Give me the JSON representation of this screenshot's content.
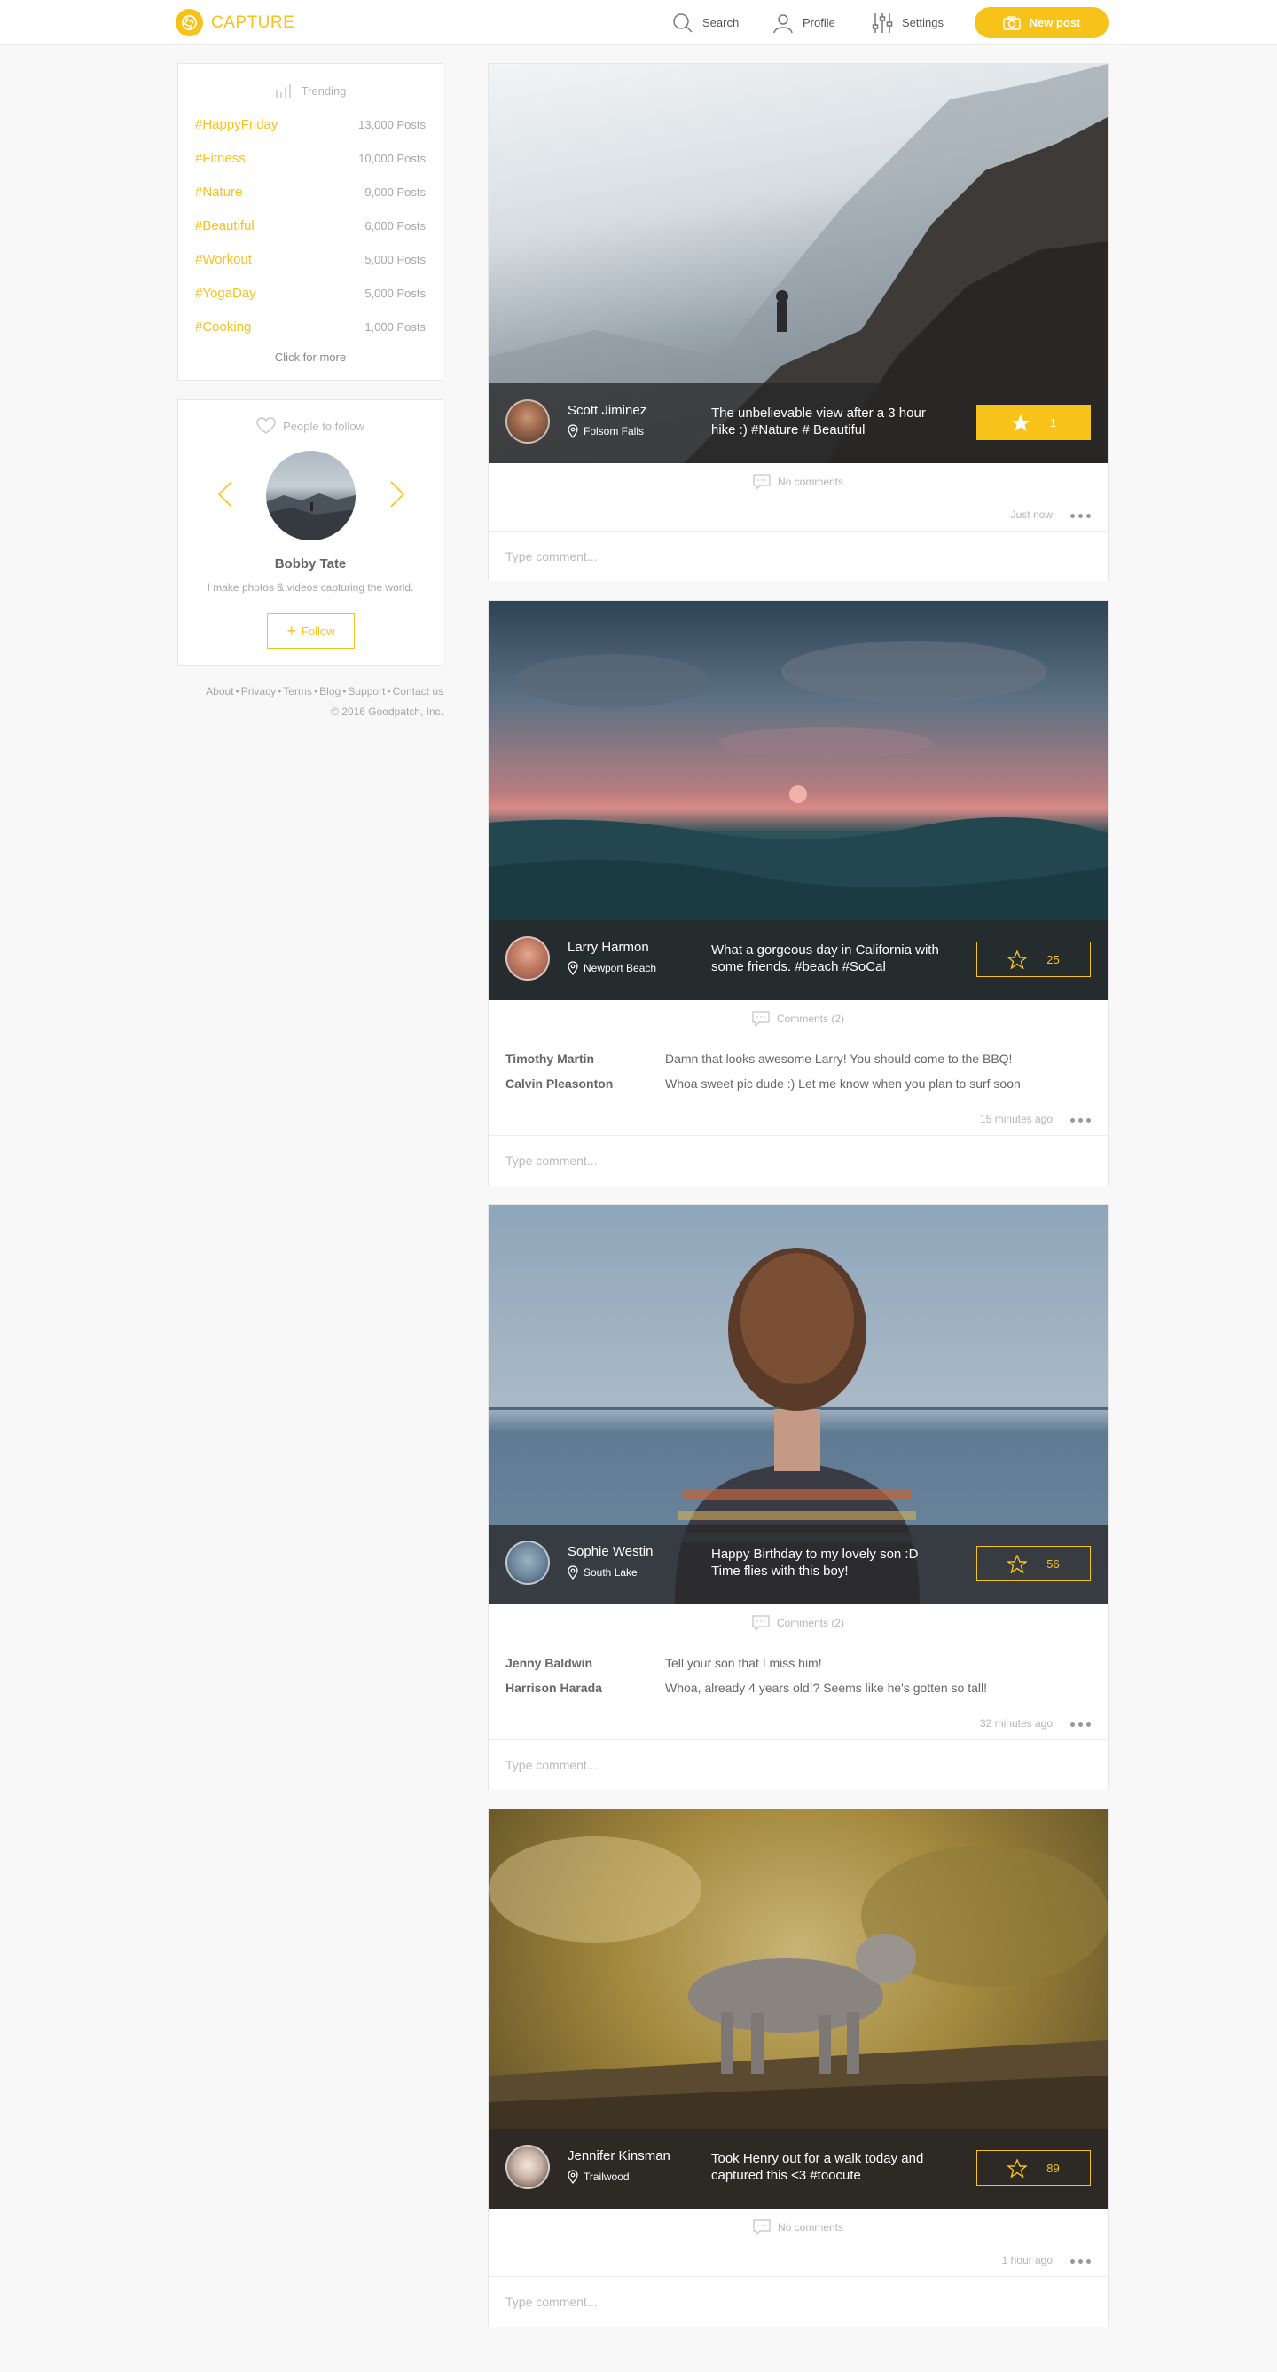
{
  "app": {
    "brand": "CAPTURE",
    "brand_color": "#f7c21a",
    "nav": {
      "search": "Search",
      "profile": "Profile",
      "settings": "Settings",
      "new_post": "New post"
    }
  },
  "trending": {
    "title": "Trending",
    "items": [
      {
        "tag": "#HappyFriday",
        "count": "13,000 Posts"
      },
      {
        "tag": "#Fitness",
        "count": "10,000 Posts"
      },
      {
        "tag": "#Nature",
        "count": "9,000 Posts"
      },
      {
        "tag": "#Beautiful",
        "count": "6,000 Posts"
      },
      {
        "tag": "#Workout",
        "count": "5,000 Posts"
      },
      {
        "tag": "#YogaDay",
        "count": "5,000 Posts"
      },
      {
        "tag": "#Cooking",
        "count": "1,000 Posts"
      }
    ],
    "more": "Click for more"
  },
  "people": {
    "title": "People to follow",
    "name": "Bobby Tate",
    "bio": "I make photos & videos capturing the world.",
    "follow": "Follow"
  },
  "footer": {
    "links": [
      "About",
      "Privacy",
      "Terms",
      "Blog",
      "Support",
      "Contact us"
    ],
    "copyright": "© 2016 Goodpatch, Inc."
  },
  "comment_placeholder": "Type comment...",
  "posts": [
    {
      "author": "Scott Jiminez",
      "location": "Folsom Falls",
      "caption": "The unbelievable view after a 3 hour hike :) #Nature # Beautiful",
      "stars": "1",
      "starred": true,
      "comments_label": "No comments",
      "comments": [],
      "time": "Just now"
    },
    {
      "author": "Larry Harmon",
      "location": "Newport Beach",
      "caption": "What a gorgeous day in California with some friends. #beach #SoCal",
      "stars": "25",
      "starred": false,
      "comments_label": "Comments (2)",
      "comments": [
        {
          "author": "Timothy Martin",
          "text": "Damn that looks awesome Larry! You should come to the BBQ!"
        },
        {
          "author": "Calvin Pleasonton",
          "text": "Whoa sweet pic dude :) Let me know when you plan to surf soon"
        }
      ],
      "time": "15 minutes ago"
    },
    {
      "author": "Sophie Westin",
      "location": "South Lake",
      "caption": "Happy Birthday to my lovely son :D Time flies with this boy!",
      "stars": "56",
      "starred": false,
      "comments_label": "Comments (2)",
      "comments": [
        {
          "author": "Jenny Baldwin",
          "text": "Tell your son that I miss him!"
        },
        {
          "author": "Harrison Harada",
          "text": "Whoa, already 4 years old!? Seems like he's gotten so tall!"
        }
      ],
      "time": "32 minutes ago"
    },
    {
      "author": "Jennifer Kinsman",
      "location": "Trailwood",
      "caption": "Took Henry out for a walk today and captured this <3 #toocute",
      "stars": "89",
      "starred": false,
      "comments_label": "No comments",
      "comments": [],
      "time": "1 hour ago"
    }
  ]
}
